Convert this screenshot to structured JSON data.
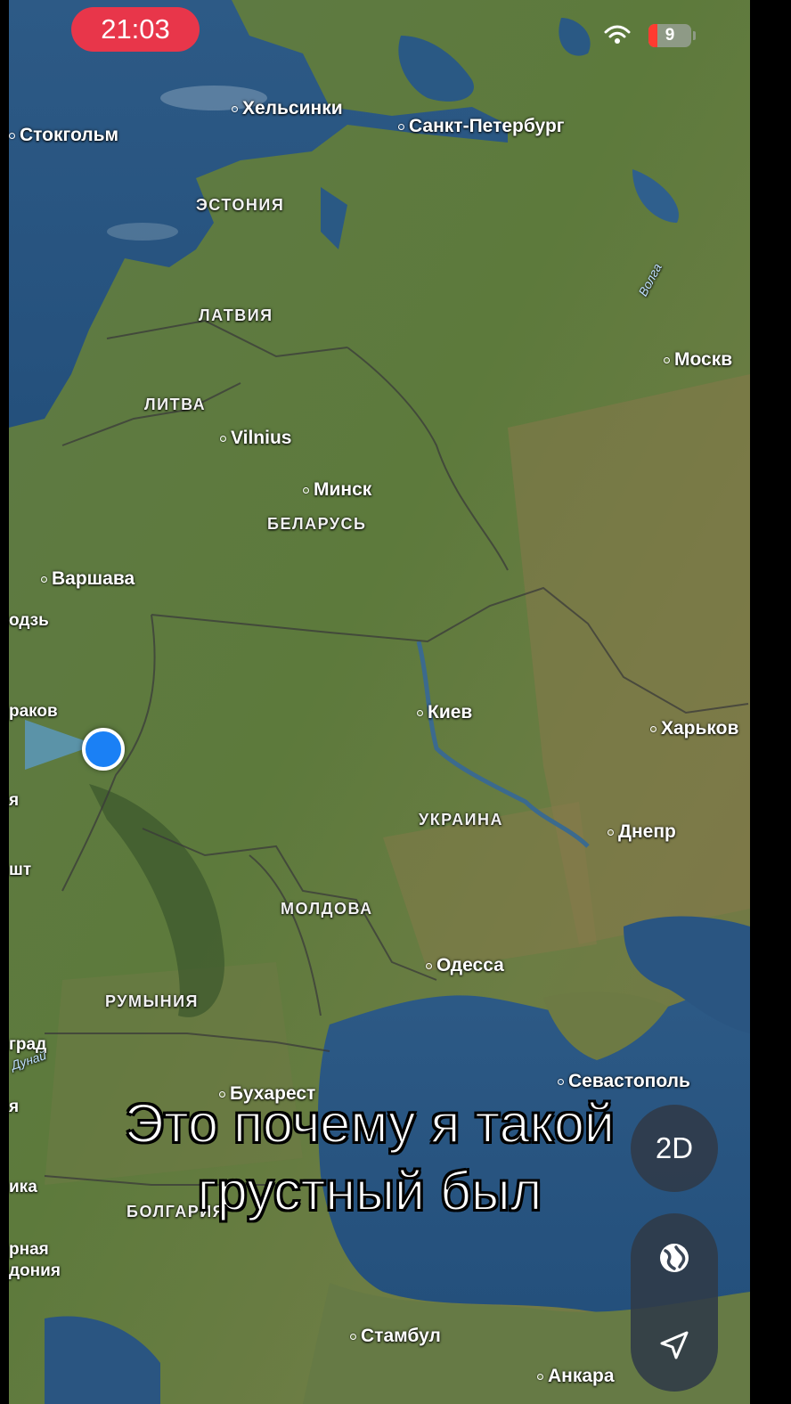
{
  "status_bar": {
    "time": "21:03",
    "battery_level": "9",
    "icons": [
      "wifi-icon",
      "battery-icon"
    ],
    "time_pill_color": "#e8364a"
  },
  "map": {
    "cities": {
      "stockholm": "Стокгольм",
      "helsinki": "Хельсинки",
      "st_petersburg": "Санкт-Петербург",
      "moscow": "Москв",
      "vilnius": "Vilnius",
      "minsk": "Минск",
      "warsaw": "Варшава",
      "lodz": "одзь",
      "krakow": "раков",
      "kyiv": "Киев",
      "kharkiv": "Харьков",
      "dnipro": "Днепр",
      "odesa": "Одесса",
      "sevastopol": "Севастополь",
      "bucharest": "Бухарест",
      "istanbul": "Стамбул",
      "ankara": "Анкара",
      "belgrade": "град"
    },
    "countries": {
      "estonia": "ЭСТОНИЯ",
      "latvia": "ЛАТВИЯ",
      "lithuania": "ЛИТВА",
      "belarus": "БЕЛАРУСЬ",
      "ukraine": "УКРАИНА",
      "moldova": "МОЛДОВА",
      "romania": "РУМЫНИЯ",
      "bulgaria": "БОЛГАРИЯ"
    },
    "rivers": {
      "volga": "Волга",
      "danube": "Дунай"
    },
    "edge_fragments": {
      "edge_1": "я",
      "edge_2": "шт",
      "edge_3": "я",
      "edge_4": "ика",
      "edge_5": "рная",
      "edge_6": "дония"
    }
  },
  "controls": {
    "view_mode_label": "2D",
    "globe_icon": "globe-icon",
    "locate_icon": "location-arrow-icon"
  },
  "caption": {
    "line_1": "Это почему я такой",
    "line_2": "грустный был"
  }
}
